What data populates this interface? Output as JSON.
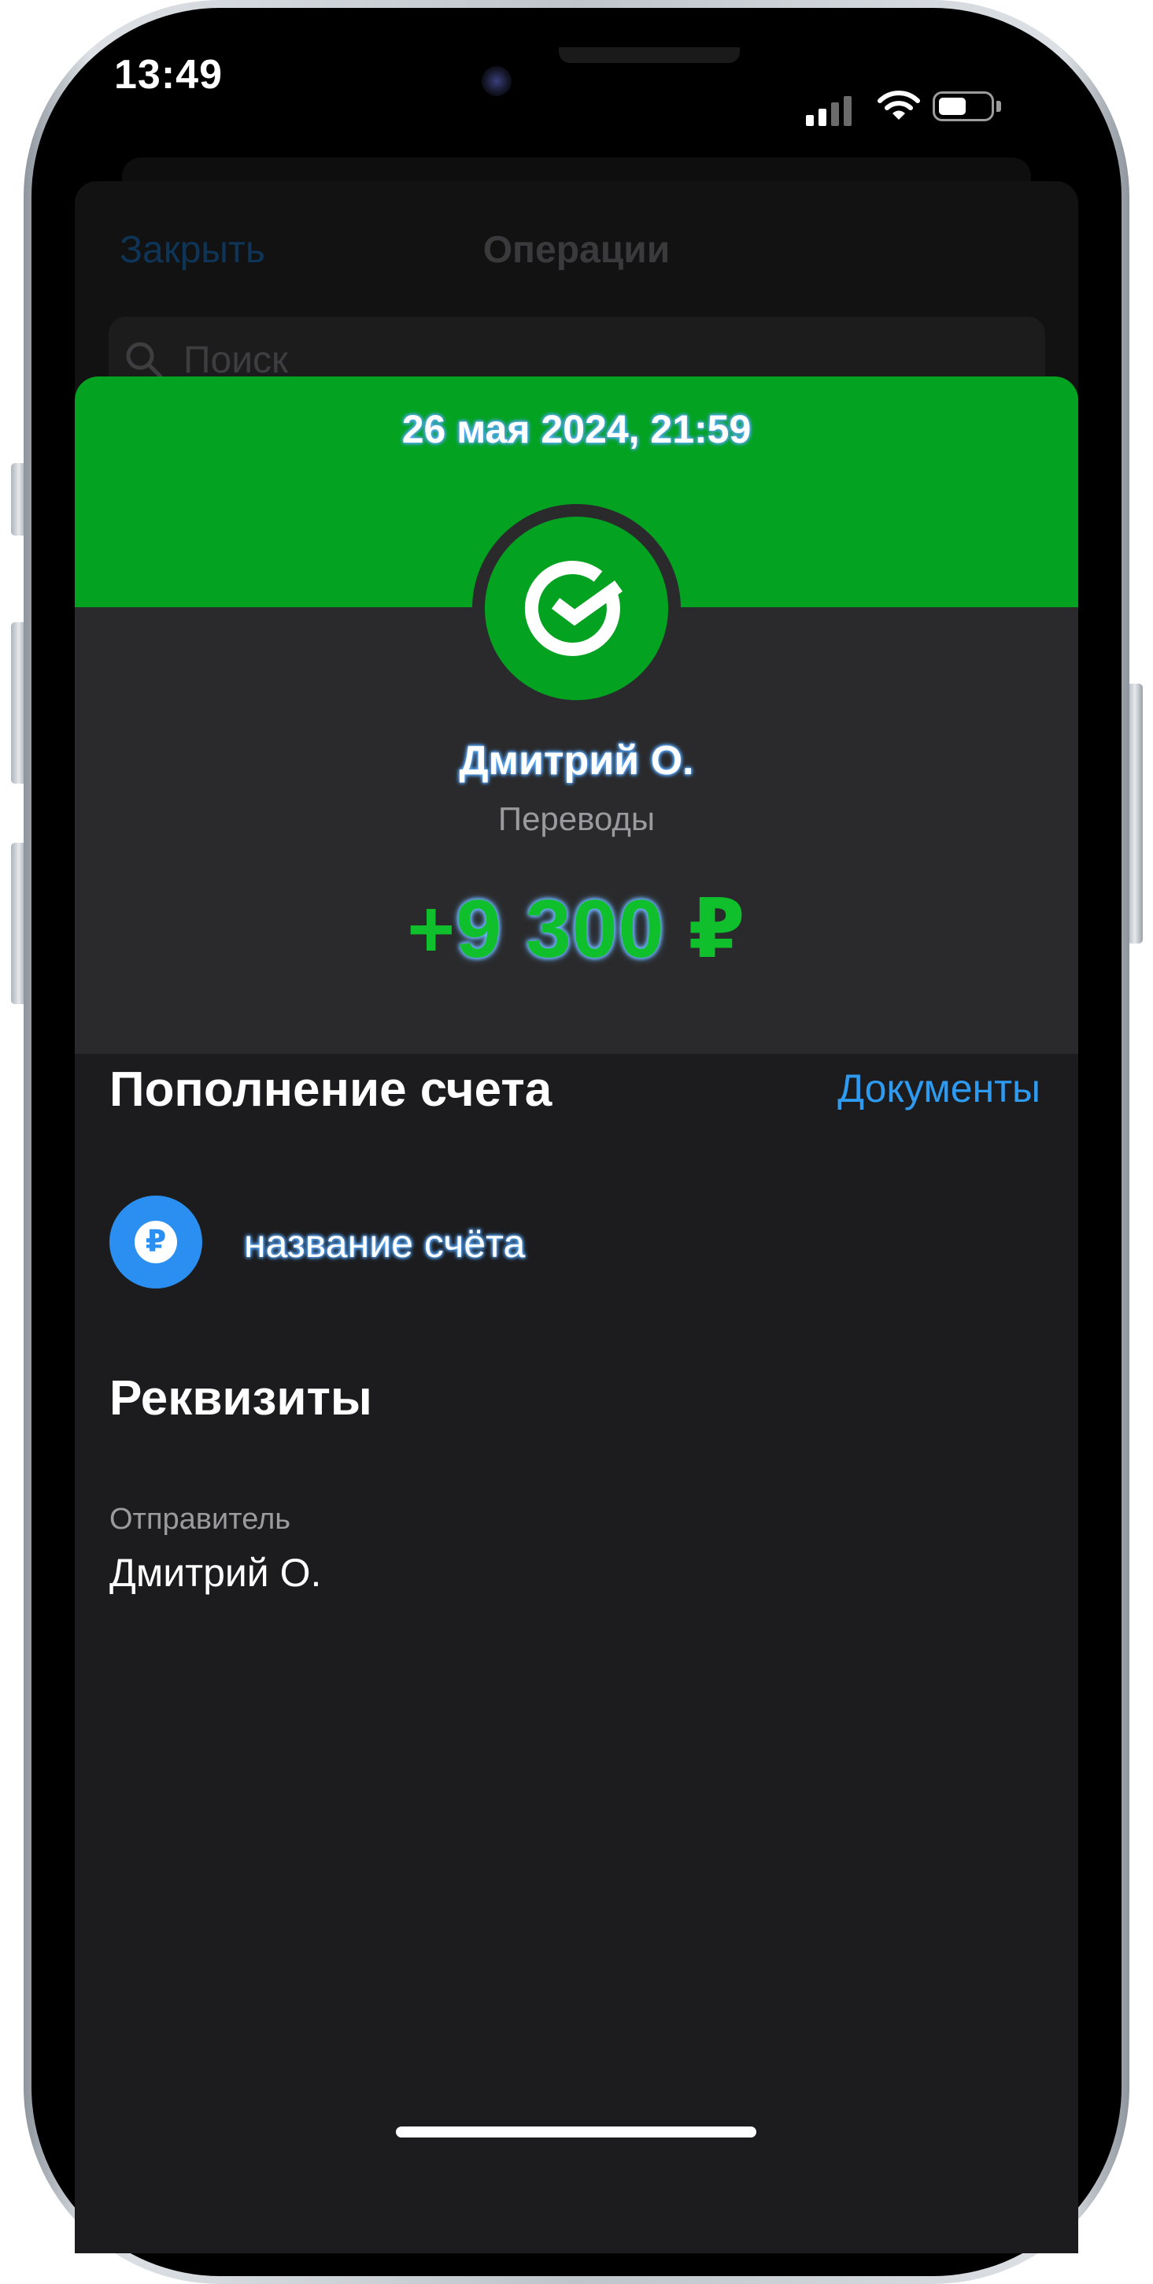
{
  "status_bar": {
    "time": "13:49",
    "battery_level": 0.5
  },
  "background_sheet": {
    "close_label": "Закрыть",
    "title": "Операции",
    "search_placeholder": "Поиск"
  },
  "transaction": {
    "datetime": "26 мая 2024, 21:59",
    "counterparty": "Дмитрий О.",
    "category": "Переводы",
    "amount_sign": "+",
    "amount": "9 300",
    "currency": "₽",
    "bank_logo": "sber-checkmark-icon"
  },
  "operation": {
    "title": "Пополнение счета",
    "documents_link": "Документы",
    "account_icon": "ruble-icon",
    "account_icon_glyph": "₽",
    "account_name": "название счёта"
  },
  "details": {
    "title": "Реквизиты",
    "sender_label": "Отправитель",
    "sender_value": "Дмитрий О."
  },
  "colors": {
    "header_green": "#03a221",
    "amount_green": "#0fbf2c",
    "link_blue": "#2e9bf0",
    "highlight_blue": "#59aaff"
  }
}
